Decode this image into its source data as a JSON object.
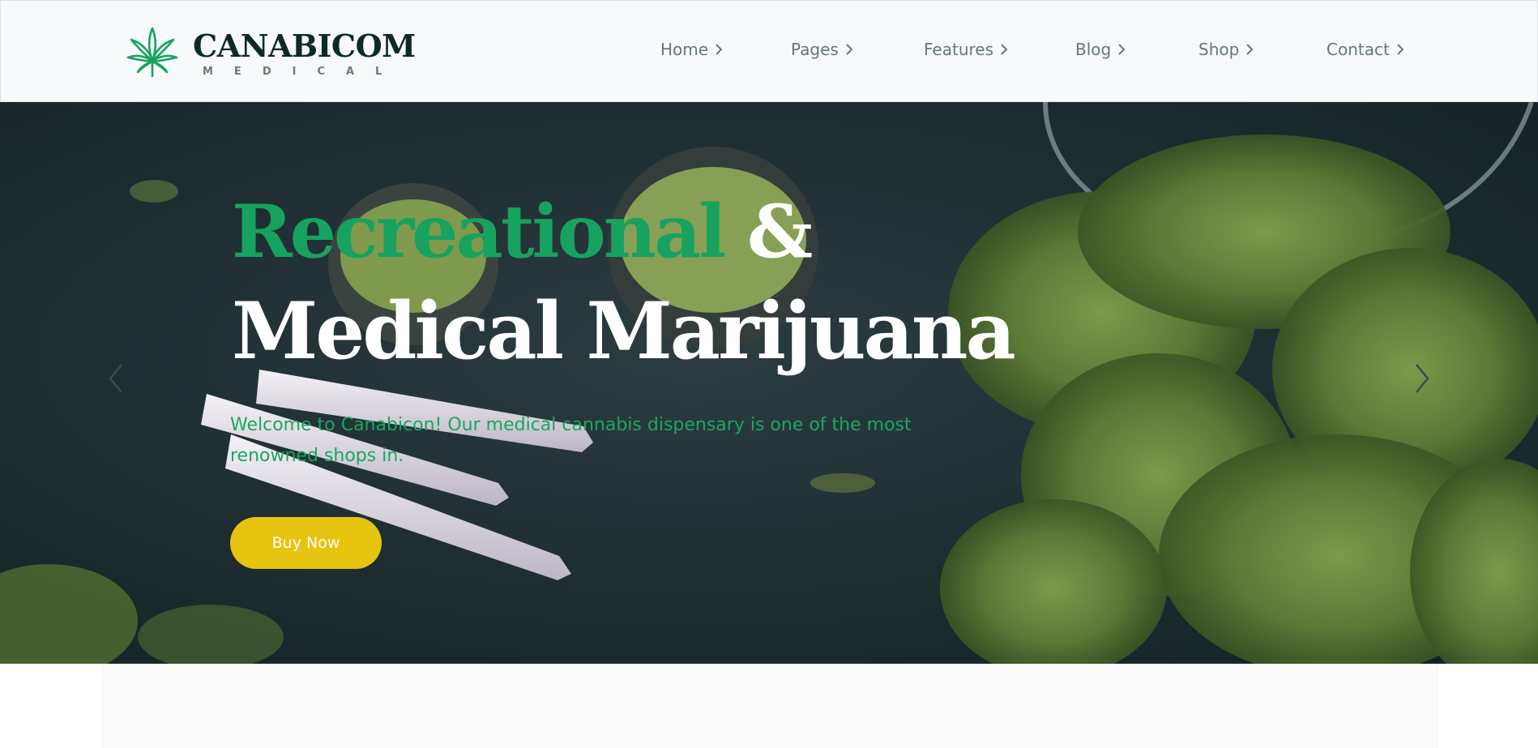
{
  "brand": {
    "name": "CANABICOM",
    "subtitle": "MEDICAL",
    "colors": {
      "dark": "#0d2a24",
      "green": "#17a35f"
    },
    "icon": "cannabis-leaf-icon"
  },
  "nav": {
    "items": [
      {
        "label": "Home"
      },
      {
        "label": "Pages"
      },
      {
        "label": "Features"
      },
      {
        "label": "Blog"
      },
      {
        "label": "Shop"
      },
      {
        "label": "Contact"
      }
    ],
    "chevron_icon": "chevron-right-icon",
    "text_color": "#66767a"
  },
  "hero": {
    "title_accent": "Recreational",
    "title_amp": " &",
    "title_line2": "Medical Marijuana",
    "description": "Welcome to Canabicon! Our medical cannabis dispensary is one of the most renowned shops in.",
    "cta_label": "Buy Now",
    "colors": {
      "accent": "#17a35f",
      "cta": "#e6c40f",
      "background": "#1f2d31"
    },
    "prev_icon": "chevron-left-icon",
    "next_icon": "chevron-right-icon"
  }
}
